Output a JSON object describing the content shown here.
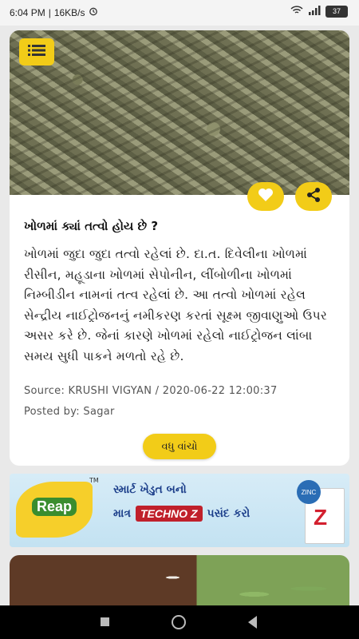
{
  "status_bar": {
    "time": "6:04 PM",
    "net_speed": "16KB/s",
    "battery": "37"
  },
  "article": {
    "title": "ખોળમાં ક્યાં તત્વો હોય છે ?",
    "body": "ખોળમાં જુદા જુદા તત્વો રહેલાં છે. દા.ત. દિવેલીના ખોળમાં રીસીન, મહૂડાના ખોળમાં સેપોનીન, લીંબોળીના ખોળમાં નિમ્બીડીન નામનાં તત્વ રહેલાં છે. આ તત્વો ખોળમાં રહેલ સેન્દ્રીય નાઈટ્રોજનનું નમીકરણ કરતાં સૂક્ષ્મ જીવાણુઓ ઉપર અસર કરે છે. જેનાં કારણે ખોળમાં રહેલો નાઈટ્રોજન લાંબા સમય સુધી પાકને મળતો રહે છે.",
    "source": "Source: KRUSHI VIGYAN / 2020-06-22 12:00:37",
    "posted_by": "Posted by: Sagar",
    "read_more": "વધુ વાંચો"
  },
  "banner": {
    "brand": "Reap",
    "line1": "સ્માર્ટ ખેડુત બનો",
    "line2_prefix": "માત્ર",
    "product": "TECHNO Z",
    "line2_suffix": "પસંદ કરો",
    "badge": "ZINC"
  },
  "icons": {
    "menu": "menu-icon",
    "like": "heart-icon",
    "share": "share-icon"
  },
  "colors": {
    "accent": "#f2cc18",
    "banner_text": "#1b3e8a",
    "product_red": "#c0202b"
  }
}
